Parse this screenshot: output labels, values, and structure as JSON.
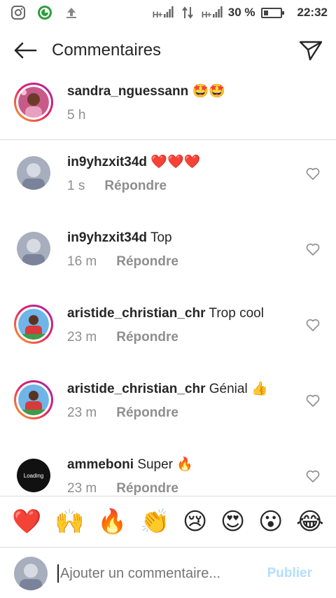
{
  "status_bar": {
    "network_1": "H+",
    "network_2": "H+",
    "battery_percent": "30 %",
    "battery_level": 0.3,
    "time": "22:32"
  },
  "header": {
    "title": "Commentaires"
  },
  "caption": {
    "username": "sandra_nguessann",
    "text": "🤩🤩",
    "time": "5 h"
  },
  "comments": [
    {
      "username": "in9yhzxit34d",
      "text": "❤️❤️❤️",
      "time": "1 s",
      "reply": "Répondre",
      "avatar_color": "#9aa4b8"
    },
    {
      "username": "in9yhzxit34d",
      "text": "Top",
      "time": "16 m",
      "reply": "Répondre",
      "avatar_color": "#9aa4b8"
    },
    {
      "username": "aristide_christian_chr",
      "text": "Trop cool",
      "time": "23 m",
      "reply": "Répondre",
      "avatar_color": "#5f9ed8"
    },
    {
      "username": "aristide_christian_chr",
      "text": "Génial 👍",
      "time": "23 m",
      "reply": "Répondre",
      "avatar_color": "#5f9ed8"
    },
    {
      "username": "ammeboni",
      "text": "Super 🔥",
      "time": "23 m",
      "reply": "Répondre",
      "avatar_color": "#111111",
      "avatar_label": "Loading"
    }
  ],
  "emoji_bar": [
    "❤️",
    "🙌",
    "🔥",
    "👏",
    "😢",
    "😍",
    "😮",
    "😂"
  ],
  "input": {
    "placeholder": "Ajouter un commentaire...",
    "publish_label": "Publier"
  },
  "colors": {
    "story_ring": "#e91e63",
    "publish_disabled": "#b2dffc",
    "muted": "#8e8e8e"
  }
}
